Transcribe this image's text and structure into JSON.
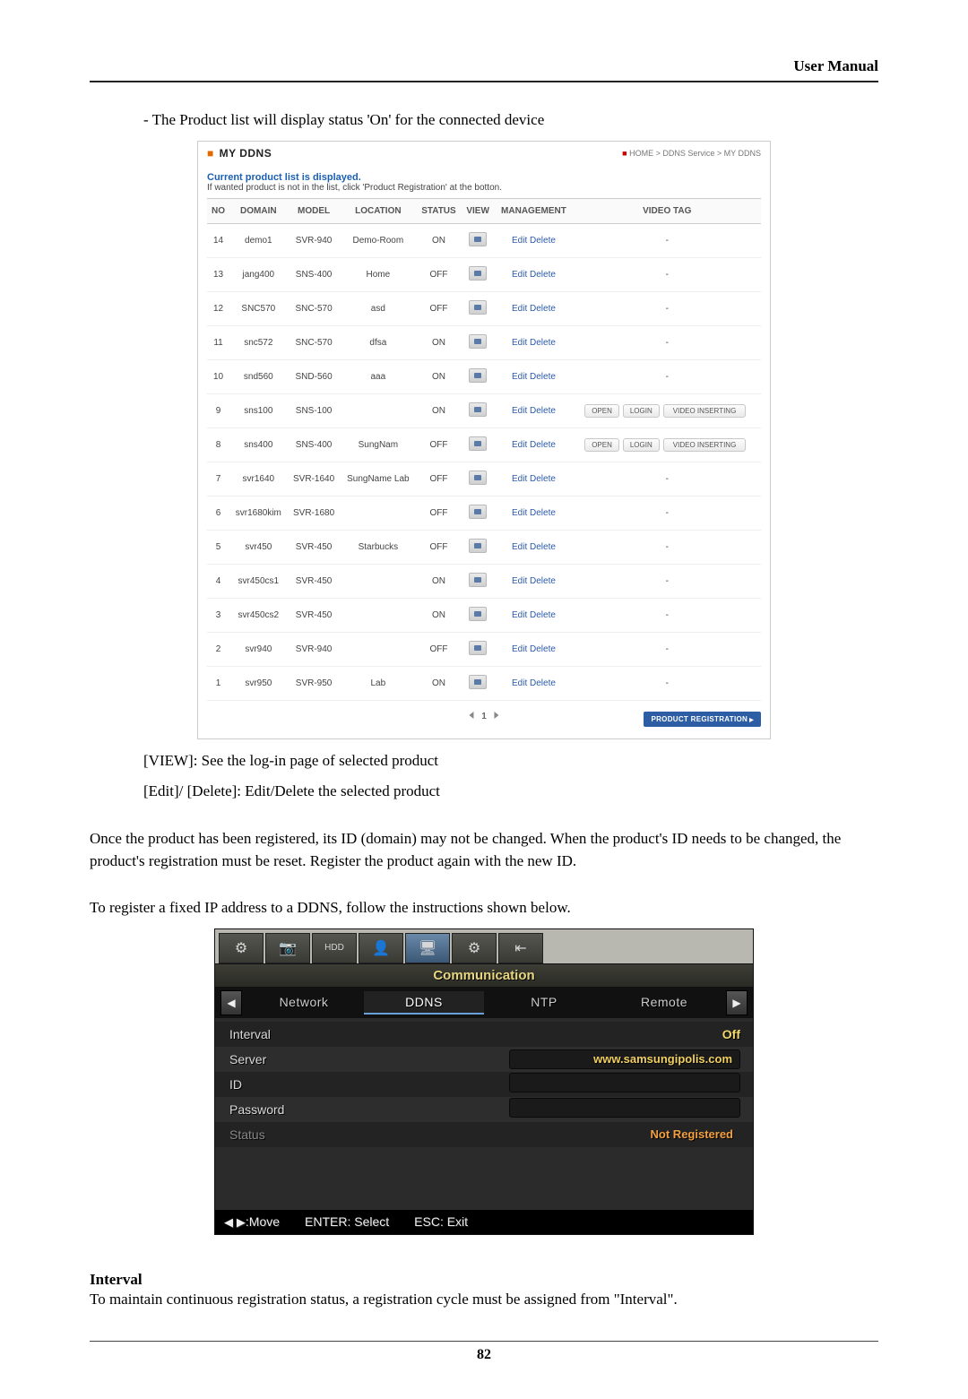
{
  "header": {
    "title": "User Manual"
  },
  "line1": "- The Product list will display status 'On' for the connected device",
  "ddns": {
    "title": "MY DDNS",
    "breadcrumb": "HOME > DDNS Service > MY DDNS",
    "sub1": "Current product list is displayed.",
    "sub2": "If wanted product is not in the list, click 'Product Registration' at the botton.",
    "cols": {
      "no": "NO",
      "domain": "DOMAIN",
      "model": "MODEL",
      "location": "LOCATION",
      "status": "STATUS",
      "view": "VIEW",
      "management": "MANAGEMENT",
      "videotag": "VIDEO TAG"
    },
    "edit": "Edit",
    "delete": "Delete",
    "dash": "-",
    "tag_open": "OPEN",
    "tag_login": "LOGIN",
    "tag_ins": "VIDEO INSERTING",
    "rows": [
      {
        "no": "14",
        "domain": "demo1",
        "model": "SVR-940",
        "location": "Demo-Room",
        "status": "ON",
        "tag": "dash"
      },
      {
        "no": "13",
        "domain": "jang400",
        "model": "SNS-400",
        "location": "Home",
        "status": "OFF",
        "tag": "dash"
      },
      {
        "no": "12",
        "domain": "SNC570",
        "model": "SNC-570",
        "location": "asd",
        "status": "OFF",
        "tag": "dash"
      },
      {
        "no": "11",
        "domain": "snc572",
        "model": "SNC-570",
        "location": "dfsa",
        "status": "ON",
        "tag": "dash"
      },
      {
        "no": "10",
        "domain": "snd560",
        "model": "SND-560",
        "location": "aaa",
        "status": "ON",
        "tag": "dash"
      },
      {
        "no": "9",
        "domain": "sns100",
        "model": "SNS-100",
        "location": "",
        "status": "ON",
        "tag": "pills"
      },
      {
        "no": "8",
        "domain": "sns400",
        "model": "SNS-400",
        "location": "SungNam",
        "status": "OFF",
        "tag": "pills"
      },
      {
        "no": "7",
        "domain": "svr1640",
        "model": "SVR-1640",
        "location": "SungName Lab",
        "status": "OFF",
        "tag": "dash"
      },
      {
        "no": "6",
        "domain": "svr1680kim",
        "model": "SVR-1680",
        "location": "",
        "status": "OFF",
        "tag": "dash"
      },
      {
        "no": "5",
        "domain": "svr450",
        "model": "SVR-450",
        "location": "Starbucks",
        "status": "OFF",
        "tag": "dash"
      },
      {
        "no": "4",
        "domain": "svr450cs1",
        "model": "SVR-450",
        "location": "",
        "status": "ON",
        "tag": "dash"
      },
      {
        "no": "3",
        "domain": "svr450cs2",
        "model": "SVR-450",
        "location": "",
        "status": "ON",
        "tag": "dash"
      },
      {
        "no": "2",
        "domain": "svr940",
        "model": "SVR-940",
        "location": "",
        "status": "OFF",
        "tag": "dash"
      },
      {
        "no": "1",
        "domain": "svr950",
        "model": "SVR-950",
        "location": "Lab",
        "status": "ON",
        "tag": "dash"
      }
    ],
    "page": "1",
    "regbtn": "PRODUCT REGISTRATION"
  },
  "line_view": "[VIEW]: See the log-in page of selected product",
  "line_edit": "[Edit]/ [Delete]: Edit/Delete the selected product",
  "para_once": "Once the product has been registered, its ID (domain) may not be changed. When the product's ID needs to be changed, the product's registration must be reset. Register the product again with the new ID.",
  "para_reg": "To register a fixed IP address to a DDNS, follow the instructions shown below.",
  "dvr": {
    "heading": "Communication",
    "tabs": {
      "network": "Network",
      "ddns": "DDNS",
      "ntp": "NTP",
      "remote": "Remote"
    },
    "rows": {
      "interval": "Interval",
      "interval_v": "Off",
      "server": "Server",
      "server_v": "www.samsungipolis.com",
      "id": "ID",
      "id_v": "",
      "password": "Password",
      "password_v": "",
      "status": "Status",
      "status_v": "Not Registered"
    },
    "footer": {
      "move": ":Move",
      "enter": "ENTER: Select",
      "esc": "ESC: Exit"
    }
  },
  "sec_interval": "Interval",
  "para_interval": "To maintain continuous registration status, a registration cycle must be assigned from \"Interval\".",
  "pagenum": "82"
}
